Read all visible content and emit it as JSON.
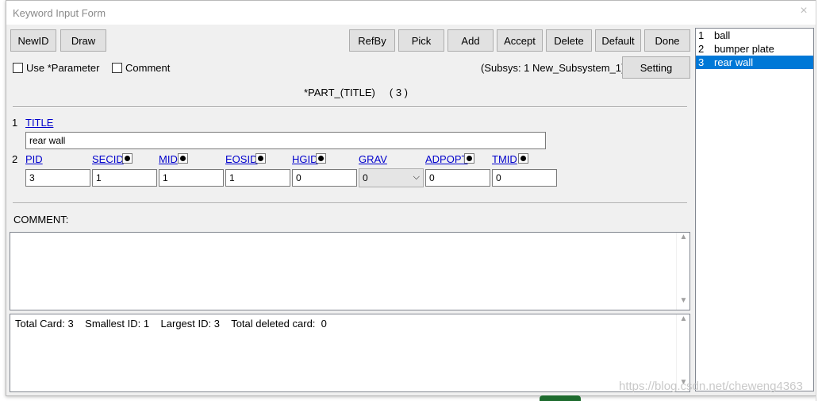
{
  "window": {
    "title": "Keyword Input Form",
    "close_glyph": "×"
  },
  "toolbar": {
    "newid": "NewID",
    "draw": "Draw",
    "refby": "RefBy",
    "pick": "Pick",
    "add": "Add",
    "accept": "Accept",
    "delete": "Delete",
    "default": "Default",
    "done": "Done"
  },
  "options": {
    "use_parameter": "Use *Parameter",
    "comment": "Comment"
  },
  "subsys": "(Subsys: 1 New_Subsystem_1)",
  "setting": "Setting",
  "keyword": {
    "title": "*PART_(TITLE)",
    "count": "( 3 )"
  },
  "card1": {
    "num": "1",
    "title_label": "TITLE",
    "title_value": "rear wall"
  },
  "card2": {
    "num": "2",
    "fields": [
      {
        "label": "PID",
        "value": "3"
      },
      {
        "label": "SECID",
        "value": "1"
      },
      {
        "label": "MID",
        "value": "1"
      },
      {
        "label": "EOSID",
        "value": "1"
      },
      {
        "label": "HGID",
        "value": "0"
      },
      {
        "label": "GRAV",
        "value": "0"
      },
      {
        "label": "ADPOPT",
        "value": "0"
      },
      {
        "label": "TMID",
        "value": "0"
      }
    ]
  },
  "comment_section": {
    "label": "COMMENT:",
    "text": ""
  },
  "stats": {
    "total_card": "Total Card: 3",
    "smallest": "Smallest ID: 1",
    "largest": "Largest ID: 3",
    "deleted": "Total deleted card:  0"
  },
  "list": [
    {
      "num": "1",
      "name": "ball"
    },
    {
      "num": "2",
      "name": "bumper plate"
    },
    {
      "num": "3",
      "name": "rear wall"
    }
  ],
  "watermark": "https://blog.csdn.net/cheweng4363",
  "colors": {
    "selection": "#0078d7",
    "link": "#0000cc",
    "button": "#e1e1e1"
  }
}
